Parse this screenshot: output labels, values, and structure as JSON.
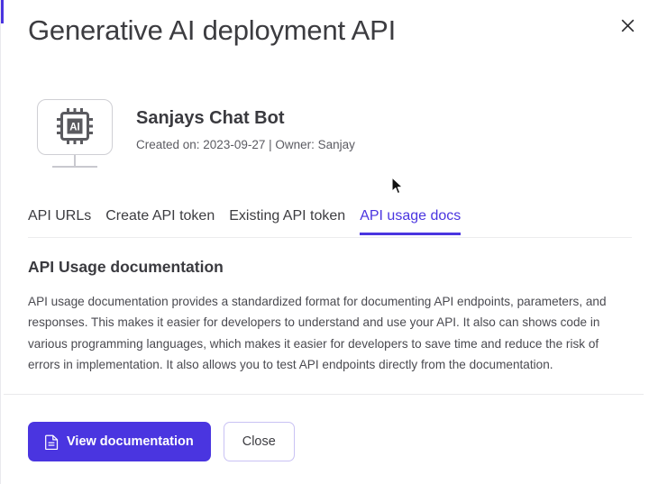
{
  "dialog": {
    "title": "Generative AI deployment API",
    "close_icon": "close-x-icon"
  },
  "product": {
    "icon": "ai-chip-monitor-icon",
    "name": "Sanjays Chat Bot",
    "meta": "Created on: 2023-09-27 | Owner: Sanjay"
  },
  "tabs": [
    {
      "label": "API URLs",
      "active": false
    },
    {
      "label": "Create API token",
      "active": false
    },
    {
      "label": "Existing API token",
      "active": false
    },
    {
      "label": "API usage docs",
      "active": true
    }
  ],
  "content": {
    "heading": "API Usage documentation",
    "body": "API usage documentation provides a standardized format for documenting API endpoints, parameters, and responses. This makes it easier for developers to understand and use your API. It also can shows code in various programming languages, which makes it easier for developers to save time and reduce the risk of errors in implementation. It also allows you to test API endpoints directly from the documentation."
  },
  "footer": {
    "primary_label": "View documentation",
    "primary_icon": "document-icon",
    "secondary_label": "Close"
  },
  "colors": {
    "accent": "#4a35e0",
    "text_primary": "#3a3a3f",
    "text_body": "#4a4a50",
    "border": "#e9e9ec"
  },
  "cursor": {
    "icon": "mouse-pointer-icon"
  }
}
